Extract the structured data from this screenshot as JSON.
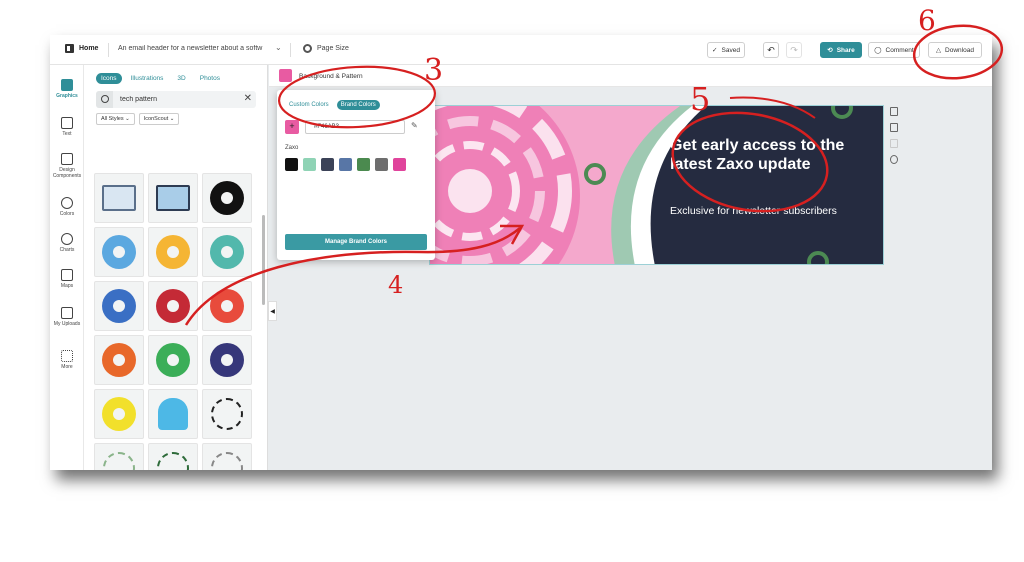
{
  "topbar": {
    "home_label": "Home",
    "doc_title": "An email header for a newsletter about a softw",
    "page_size_label": "Page Size",
    "saved_label": "Saved",
    "share_label": "Share",
    "comment_label": "Comment",
    "download_label": "Download"
  },
  "rail": {
    "items": [
      {
        "label": "Graphics",
        "icon": "graphics-icon"
      },
      {
        "label": "Text",
        "icon": "text-icon"
      },
      {
        "label": "Design Components",
        "icon": "components-icon"
      },
      {
        "label": "Colors",
        "icon": "palette-icon"
      },
      {
        "label": "Charts",
        "icon": "chart-icon"
      },
      {
        "label": "Maps",
        "icon": "map-icon"
      },
      {
        "label": "My Uploads",
        "icon": "folder-icon"
      },
      {
        "label": "More",
        "icon": "grid-icon"
      }
    ]
  },
  "panel": {
    "tabs": [
      "Icons",
      "Illustrations",
      "3D",
      "Photos"
    ],
    "search_value": "tech pattern",
    "filter_styles": "All Styles",
    "filter_source": "IconScout"
  },
  "canvas": {
    "background_label": "Background & Pattern",
    "headline": "Get early access to the latest Zaxo update",
    "subtext": "Exclusive for newsletter subscribers"
  },
  "popup": {
    "tab_custom": "Custom Colors",
    "tab_brand": "Brand Colors",
    "hex_value": "#F46AB3",
    "add_symbol": "+",
    "brand_name": "Zaxo",
    "swatches": [
      "#111111",
      "#8fd3b5",
      "#3b4257",
      "#5876a6",
      "#4b8a4f",
      "#6e6e6e",
      "#e0449c"
    ],
    "manage_label": "Manage Brand Colors"
  },
  "annotations": {
    "step3": "3",
    "step4": "4",
    "step5": "5",
    "step6": "6"
  },
  "colors": {
    "accent": "#2f8e98",
    "brand_pink": "#e85ba2",
    "banner_dark": "#252b40",
    "annotation_red": "#d62020"
  }
}
